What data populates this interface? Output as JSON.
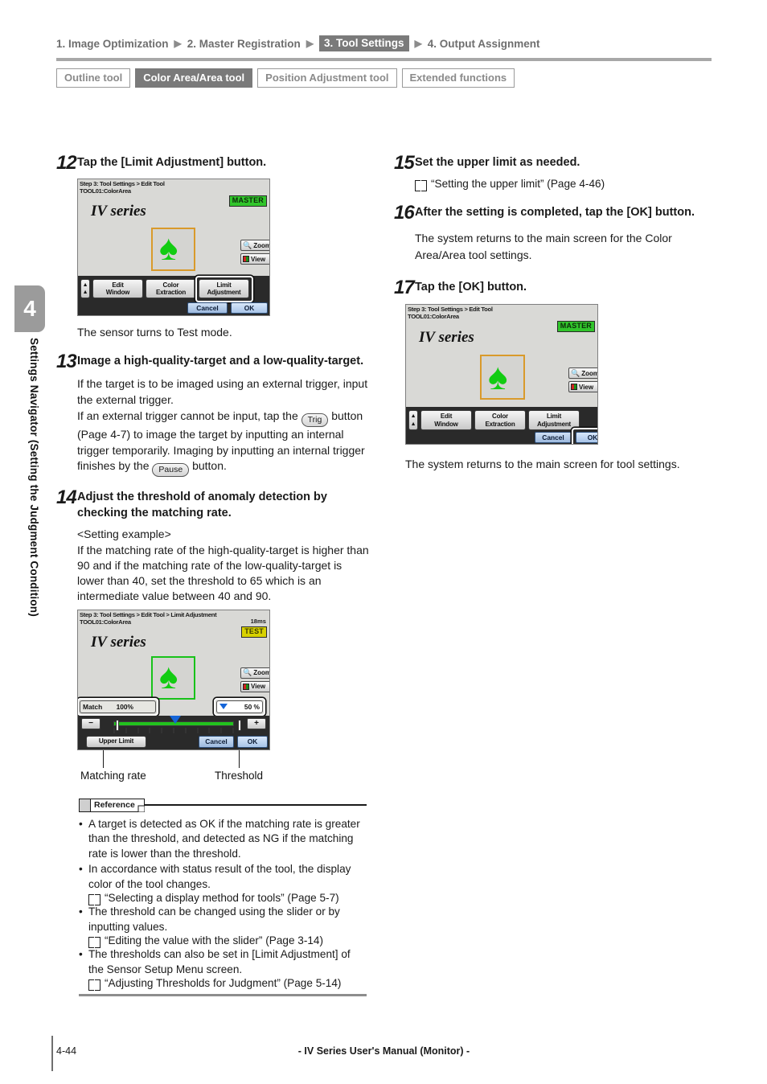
{
  "nav": {
    "breadcrumb": [
      {
        "label": "1. Image Optimization",
        "active": false
      },
      {
        "label": "2. Master Registration",
        "active": false
      },
      {
        "label": "3. Tool Settings",
        "active": true
      },
      {
        "label": "4. Output Assignment",
        "active": false
      }
    ],
    "tabs": [
      {
        "label": "Outline tool",
        "active": false
      },
      {
        "label": "Color Area/Area tool",
        "active": true
      },
      {
        "label": "Position Adjustment tool",
        "active": false
      },
      {
        "label": "Extended functions",
        "active": false
      }
    ]
  },
  "sidebar": {
    "chapter": "4",
    "label": "Settings Navigator (Setting the Judgment Condition)"
  },
  "left": {
    "step12": {
      "num": "12",
      "title": "Tap the [Limit Adjustment] button.",
      "after": "The sensor turns to Test mode."
    },
    "shot1": {
      "header_line1": "Step 3: Tool Settings > Edit Tool",
      "header_line2": "TOOL01:ColorArea",
      "badge": "MASTER",
      "logo": "IV series",
      "zoom_btn": "Zoom",
      "view_btn": "View",
      "buttons": [
        "Edit Window",
        "Color Extraction",
        "Limit Adjustment"
      ],
      "cancel": "Cancel",
      "ok": "OK",
      "highlight": "Limit Adjustment"
    },
    "step13": {
      "num": "13",
      "title": "Image a high-quality-target and a low-quality-target.",
      "p1": "If the target is to be imaged using an external trigger, input the external trigger.",
      "p2a": "If an external trigger cannot be input, tap the",
      "trig_btn": "Trig",
      "p2b": "button (Page 4-7) to image the target by inputting an internal trigger temporarily. Imaging by inputting an internal trigger finishes by the",
      "pause_btn": "Pause",
      "p2c": "button."
    },
    "step14": {
      "num": "14",
      "title": "Adjust the threshold of anomaly detection by checking the matching rate.",
      "example_head": "<Setting example>",
      "example_body": "If the matching rate of the high-quality-target is higher than 90 and if the matching rate of the low-quality-target is lower than 40, set the threshold to 65 which is an intermediate value between 40 and 90."
    },
    "shot2": {
      "header_line1": "Step 3: Tool Settings > Edit Tool > Limit Adjustment",
      "header_line2": "TOOL01:ColorArea",
      "ms": "18ms",
      "badge": "TEST",
      "logo": "IV series",
      "zoom_btn": "Zoom",
      "view_btn": "View",
      "match_label": "Match",
      "match_value": "100%",
      "threshold_value": "50 %",
      "minus": "−",
      "plus": "+",
      "upper_limit": "Upper Limit",
      "cancel": "Cancel",
      "ok": "OK"
    },
    "callouts": {
      "matching_rate": "Matching rate",
      "threshold": "Threshold"
    },
    "reference": {
      "tag": "Reference",
      "items": [
        {
          "text": "A target is detected as OK if the matching rate is greater than the threshold, and detected as NG if the matching rate is lower than the threshold.",
          "link": null
        },
        {
          "text": "In accordance with status result of the tool, the display color of the tool changes.",
          "link": "“Selecting a display method for tools” (Page 5-7)"
        },
        {
          "text": "The threshold can be changed using the slider or by inputting values.",
          "link": "“Editing the value with the slider” (Page 3-14)"
        },
        {
          "text": "The thresholds can also be set in [Limit Adjustment] of the Sensor Setup Menu screen.",
          "link": "“Adjusting Thresholds for Judgment” (Page 5-14)"
        }
      ]
    }
  },
  "right": {
    "step15": {
      "num": "15",
      "title": "Set the upper limit as needed.",
      "link": "“Setting the upper limit” (Page 4-46)"
    },
    "step16": {
      "num": "16",
      "title": "After the setting is completed, tap the [OK] button.",
      "after": "The system returns to the main screen for the Color Area/Area tool settings."
    },
    "step17": {
      "num": "17",
      "title": "Tap the [OK] button.",
      "after": "The system returns to the main screen for tool settings."
    },
    "shot3": {
      "header_line1": "Step 3: Tool Settings > Edit Tool",
      "header_line2": "TOOL01:ColorArea",
      "badge": "MASTER",
      "logo": "IV series",
      "zoom_btn": "Zoom",
      "view_btn": "View",
      "buttons": [
        "Edit Window",
        "Color Extraction",
        "Limit Adjustment"
      ],
      "cancel": "Cancel",
      "ok": "OK",
      "highlight": "OK"
    }
  },
  "footer": {
    "page": "4-44",
    "title": "- IV Series User's Manual (Monitor) -"
  },
  "colors": {
    "accent_gray": "#7a7a7a",
    "master_green": "#31c52b",
    "test_yellow": "#d8d200",
    "spade_green": "#12cc12",
    "slider_green": "#22c21e",
    "roi_orange": "#d99a2b"
  }
}
